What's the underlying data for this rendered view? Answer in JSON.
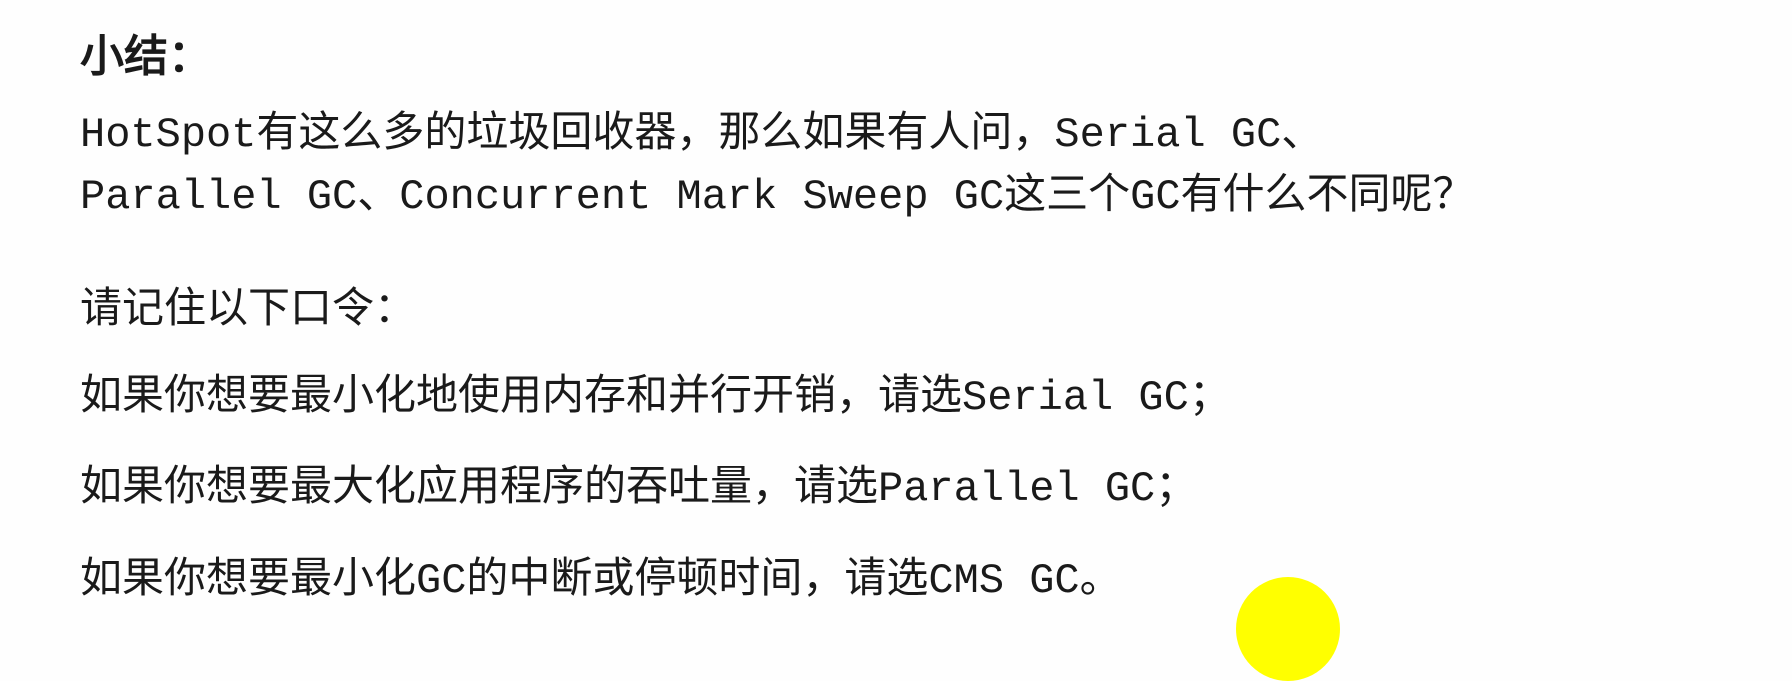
{
  "title": "小结：",
  "intro": [
    "HotSpot有这么多的垃圾回收器，那么如果有人问，Serial GC、",
    "Parallel GC、Concurrent Mark Sweep GC这三个GC有什么不同呢？"
  ],
  "mnemonic_heading": "请记住以下口令：",
  "rules": [
    "如果你想要最小化地使用内存和并行开销，请选Serial GC；",
    "如果你想要最大化应用程序的吞吐量，请选Parallel GC；",
    "如果你想要最小化GC的中断或停顿时间，请选CMS GC。"
  ],
  "cursor_highlight_color": "#ffff00"
}
